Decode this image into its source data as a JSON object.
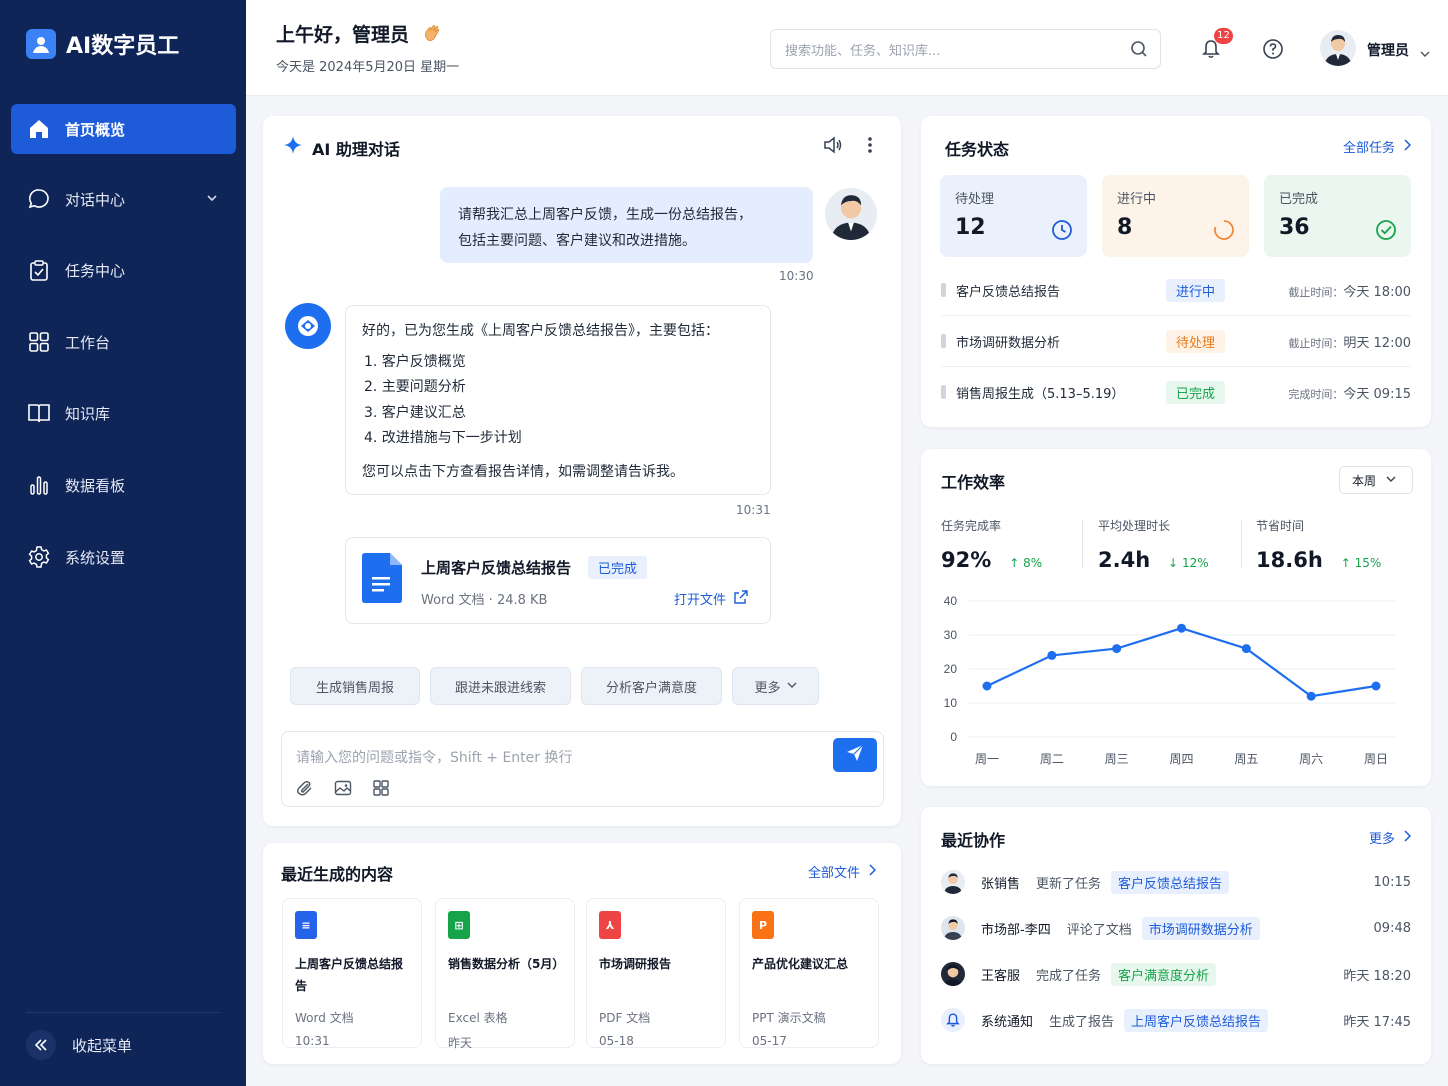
{
  "brand": {
    "name": "AI数字员工"
  },
  "nav": {
    "items": [
      {
        "label": "首页概览",
        "icon": "home-icon"
      },
      {
        "label": "对话中心",
        "icon": "chat-icon"
      },
      {
        "label": "任务中心",
        "icon": "clipboard-icon"
      },
      {
        "label": "工作台",
        "icon": "grid-icon"
      },
      {
        "label": "知识库",
        "icon": "book-icon"
      },
      {
        "label": "数据看板",
        "icon": "bar-chart-icon"
      },
      {
        "label": "系统设置",
        "icon": "gear-icon"
      }
    ],
    "collapse_label": "收起菜单"
  },
  "header": {
    "greeting": "上午好，管理员",
    "date": "今天是 2024年5月20日 星期一",
    "search_placeholder": "搜索功能、任务、知识库...",
    "notif_count": "12",
    "user_name": "管理员"
  },
  "chat": {
    "title": "AI 助理对话",
    "user_message": [
      "请帮我汇总上周客户反馈，生成一份总结报告，",
      "包括主要问题、客户建议和改进措施。"
    ],
    "user_time": "10:30",
    "ai_intro": "好的，已为您生成《上周客户反馈总结报告》，主要包括：",
    "ai_list": [
      "1.  客户反馈概览",
      "2.  主要问题分析",
      "3.  客户建议汇总",
      "4.  改进措施与下一步计划"
    ],
    "ai_outro": "您可以点击下方查看报告详情，如需调整请告诉我。",
    "ai_time": "10:31",
    "file": {
      "name": "上周客户反馈总结报告",
      "status": "已完成",
      "meta": "Word 文档 · 24.8 KB",
      "open_label": "打开文件"
    },
    "chips": [
      "生成销售周报",
      "跟进未跟进线索",
      "分析客户满意度",
      "更多"
    ],
    "input_placeholder": "请输入您的问题或指令，Shift + Enter 换行"
  },
  "tasks": {
    "title": "任务状态",
    "link": "全部任务",
    "stats": [
      {
        "label": "待处理",
        "value": "12",
        "color": "#1e5bd8"
      },
      {
        "label": "进行中",
        "value": "8",
        "color": "#f08a3c"
      },
      {
        "label": "已完成",
        "value": "36",
        "color": "#16a34a"
      }
    ],
    "rows": [
      {
        "title": "客户反馈总结报告",
        "status": "进行中",
        "meta_label": "截止时间：",
        "meta_value": "今天 18:00"
      },
      {
        "title": "市场调研数据分析",
        "status": "待处理",
        "meta_label": "截止时间：",
        "meta_value": "明天 12:00"
      },
      {
        "title": "销售周报生成（5.13–5.19）",
        "status": "已完成",
        "meta_label": "完成时间：",
        "meta_value": "今天 09:15"
      }
    ]
  },
  "efficiency": {
    "title": "工作效率",
    "period": "本周",
    "kpis": [
      {
        "label": "任务完成率",
        "value": "92%",
        "change": "↑ 8%"
      },
      {
        "label": "平均处理时长",
        "value": "2.4h",
        "change": "↓ 12%"
      },
      {
        "label": "节省时间",
        "value": "18.6h",
        "change": "↑ 15%"
      }
    ]
  },
  "chart_data": {
    "type": "line",
    "categories": [
      "周一",
      "周二",
      "周三",
      "周四",
      "周五",
      "周六",
      "周日"
    ],
    "values": [
      15,
      24,
      26,
      32,
      26,
      12,
      15
    ],
    "y_ticks": [
      0,
      10,
      20,
      30,
      40
    ],
    "ylim": [
      0,
      40
    ],
    "grid": true,
    "color": "#1e6ff0"
  },
  "recent_content": {
    "title": "最近生成的内容",
    "link": "全部文件",
    "items": [
      {
        "title": "上周客户反馈总结报告",
        "kind": "Word 文档",
        "date": "10:31",
        "color": "#2563eb",
        "icon": "word-icon"
      },
      {
        "title": "销售数据分析（5月）",
        "kind": "Excel 表格",
        "date": "昨天",
        "color": "#16a34a",
        "icon": "excel-icon"
      },
      {
        "title": "市场调研报告",
        "kind": "PDF 文档",
        "date": "05-18",
        "color": "#ef4444",
        "icon": "pdf-icon"
      },
      {
        "title": "产品优化建议汇总",
        "kind": "PPT 演示文稿",
        "date": "05-17",
        "color": "#f97316",
        "icon": "ppt-icon"
      }
    ]
  },
  "collab": {
    "title": "最近协作",
    "link": "更多",
    "rows": [
      {
        "name": "张销售",
        "action": "更新了任务",
        "target": "客户反馈总结报告",
        "time": "10:15"
      },
      {
        "name": "市场部-李四",
        "action": "评论了文档",
        "target": "市场调研数据分析",
        "time": "09:48"
      },
      {
        "name": "王客服",
        "action": "完成了任务",
        "target": "客户满意度分析",
        "time": "昨天 18:20"
      },
      {
        "name": "系统通知",
        "action": "生成了报告",
        "target": "上周客户反馈总结报告",
        "time": "昨天 17:45"
      }
    ]
  }
}
